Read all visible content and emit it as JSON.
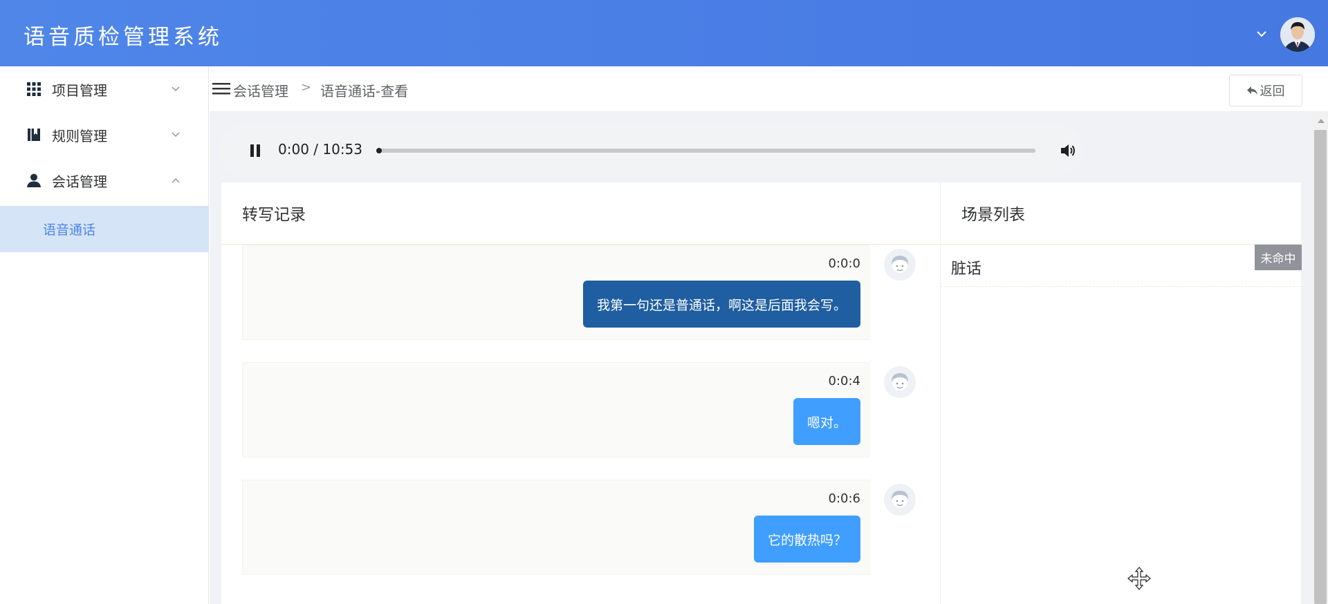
{
  "header": {
    "app_title": "语音质检管理系统",
    "user_menu_icon": "chevron-down-icon",
    "avatar_icon": "user-avatar"
  },
  "sidebar": {
    "items": [
      {
        "label": "项目管理",
        "icon": "grid-icon",
        "arrow": "chevron-down-icon",
        "expanded": false
      },
      {
        "label": "规则管理",
        "icon": "book-icon",
        "arrow": "chevron-down-icon",
        "expanded": false
      },
      {
        "label": "会话管理",
        "icon": "user-icon",
        "arrow": "chevron-up-icon",
        "expanded": true
      }
    ],
    "subitems": [
      {
        "label": "语音通话",
        "active": true
      }
    ]
  },
  "breadcrumb": {
    "menu_icon": "hamburger-icon",
    "items": [
      "会话管理",
      "语音通话-查看"
    ],
    "separator": ">"
  },
  "actions": {
    "back_label": "返回",
    "back_icon": "reply-arrow-icon"
  },
  "player": {
    "state_icon": "pause-icon",
    "time": "0:00 / 10:53",
    "progress": 0,
    "volume_icon": "volume-icon"
  },
  "transcript": {
    "title": "转写记录",
    "messages": [
      {
        "time": "0:0:0",
        "text": "我第一句还是普通话，啊这是后面我会写。",
        "style": "dark"
      },
      {
        "time": "0:0:4",
        "text": "嗯对。",
        "style": "light"
      },
      {
        "time": "0:0:6",
        "text": "它的散热吗？",
        "style": "light"
      }
    ]
  },
  "scenes": {
    "title": "场景列表",
    "items": [
      {
        "name": "脏话",
        "status": "未命中"
      }
    ]
  },
  "colors": {
    "header_bg": "#4a7fe6",
    "menu_active_bg": "#d6e4f8",
    "menu_active_text": "#4a86e8",
    "bubble_dark": "#1f5ea0",
    "bubble_light": "#409eff",
    "badge_gray": "#909399"
  }
}
